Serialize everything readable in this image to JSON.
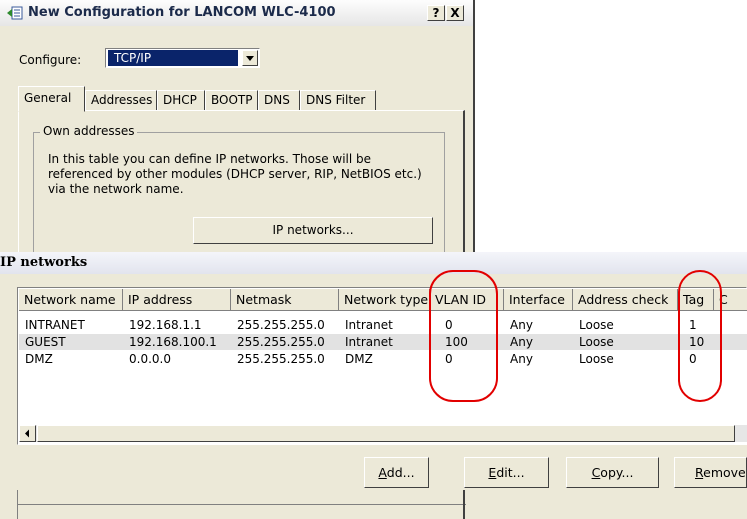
{
  "config_window": {
    "title": "New Configuration for LANCOM WLC-4100",
    "help_button": "?",
    "close_button": "X",
    "configure_label": "Configure:",
    "configure_value": "TCP/IP",
    "tabs": [
      {
        "label": "General",
        "active": true
      },
      {
        "label": "Addresses",
        "active": false
      },
      {
        "label": "DHCP",
        "active": false
      },
      {
        "label": "BOOTP",
        "active": false
      },
      {
        "label": "DNS",
        "active": false
      },
      {
        "label": "DNS Filter",
        "active": false
      }
    ],
    "group_title": "Own addresses",
    "group_text": "In this table you can define IP networks. Those will be referenced by other modules (DHCP server, RIP, NetBIOS etc.) via the network name.",
    "ip_networks_button": "IP networks..."
  },
  "ipnet_window": {
    "title": "IP networks",
    "columns": [
      "Network name",
      "IP address",
      "Netmask",
      "Network type",
      "VLAN ID",
      "Interface",
      "Address check",
      "Tag",
      "C"
    ],
    "rows": [
      [
        "INTRANET",
        "192.168.1.1",
        "255.255.255.0",
        "Intranet",
        "0",
        "Any",
        "Loose",
        "1"
      ],
      [
        "GUEST",
        "192.168.100.1",
        "255.255.255.0",
        "Intranet",
        "100",
        "Any",
        "Loose",
        "10"
      ],
      [
        "DMZ",
        "0.0.0.0",
        "255.255.255.0",
        "DMZ",
        "0",
        "Any",
        "Loose",
        "0"
      ]
    ],
    "buttons": {
      "add": {
        "mnemonic": "A",
        "rest": "dd..."
      },
      "edit": {
        "mnemonic": "E",
        "rest": "dit..."
      },
      "copy": {
        "mnemonic": "C",
        "rest": "opy..."
      },
      "remove": {
        "mnemonic": "R",
        "rest": "emove"
      }
    }
  },
  "annotations": {
    "highlight_color": "#e20000"
  },
  "colors": {
    "selection": "#0a246a",
    "face": "#ece9d8"
  }
}
